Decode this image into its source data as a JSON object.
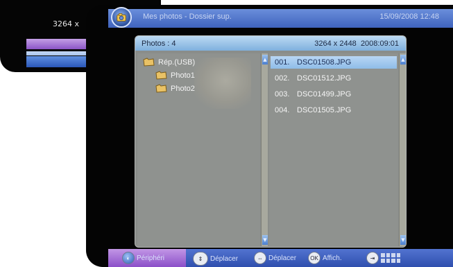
{
  "background_screen": {
    "resolution_text": "3264 x"
  },
  "window": {
    "title": "Mes photos - Dossier sup.",
    "datetime": "15/09/2008 12:48"
  },
  "info_bar": {
    "photos_label": "Photos :  4",
    "resolution": "3264 x 2448",
    "date": "2008:09:01"
  },
  "folders": [
    {
      "label": "Rép.(USB)",
      "icon": "folder-icon"
    },
    {
      "label": "Photo1",
      "icon": "folder-icon"
    },
    {
      "label": "Photo2",
      "icon": "folder-icon"
    }
  ],
  "files": [
    {
      "num": "001.",
      "name": "DSC01508.JPG",
      "selected": true
    },
    {
      "num": "002.",
      "name": "DSC01512.JPG",
      "selected": false
    },
    {
      "num": "003.",
      "name": "DSC01499.JPG",
      "selected": false
    },
    {
      "num": "004.",
      "name": "DSC01505.JPG",
      "selected": false
    }
  ],
  "help_bar": {
    "peripheral_label": "Périphéri",
    "move_updown_label": "Déplacer",
    "move_leftright_label": "Déplacer",
    "view_label": "Affich.",
    "ok_symbol": "OK"
  },
  "colors": {
    "title_bar": "#4f72c9",
    "info_bar": "#a6ccef",
    "selection": "#a8cdf0",
    "purple_accent": "#a877d8"
  }
}
